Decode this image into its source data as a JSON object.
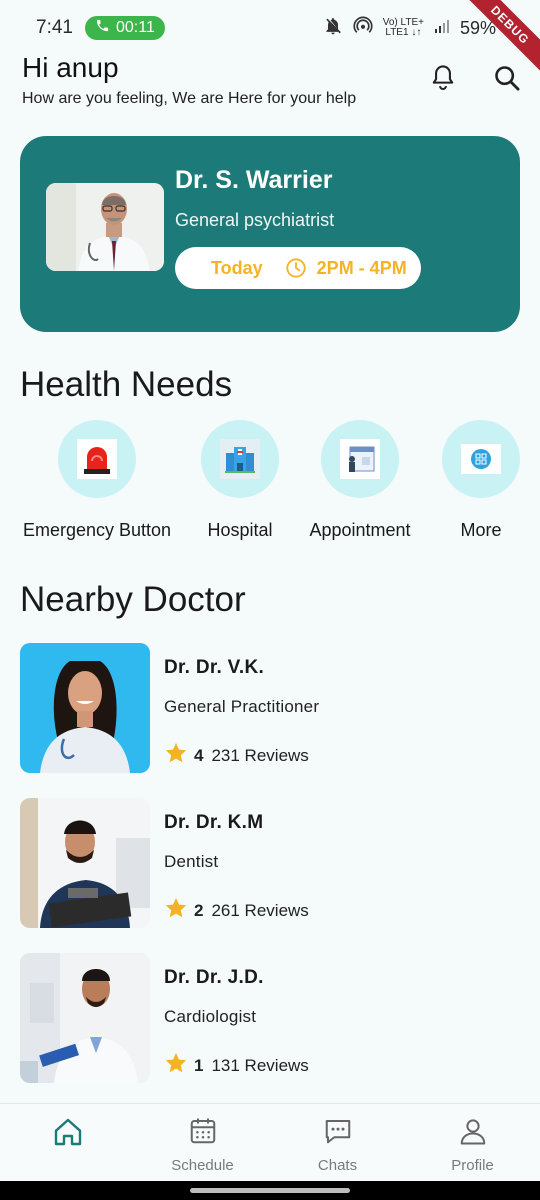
{
  "status_bar": {
    "time": "7:41",
    "call_timer": "00:11",
    "network_top": "Vo) LTE+",
    "network_bottom": "LTE1 ↓↑",
    "battery": "59%",
    "debug_label": "DEBUG"
  },
  "header": {
    "greeting": "Hi anup",
    "subtitle": "How are you feeling, We are Here for your help"
  },
  "appointment": {
    "doctor_name": "Dr. S. Warrier",
    "specialty": "General psychiatrist",
    "day": "Today",
    "time": "2PM - 4PM",
    "card_color": "#1c7b78",
    "accent_color": "#f5b324"
  },
  "health_needs": {
    "title": "Health Needs",
    "items": [
      {
        "label": "Emergency Button",
        "icon": "emergency-siren-icon"
      },
      {
        "label": "Hospital",
        "icon": "hospital-icon"
      },
      {
        "label": "Appointment",
        "icon": "appointment-icon"
      },
      {
        "label": "More",
        "icon": "more-services-icon"
      }
    ]
  },
  "nearby": {
    "title": "Nearby Doctor",
    "doctors": [
      {
        "name": "Dr. Dr. V.K.",
        "specialty": "General Practitioner",
        "rating": "4",
        "reviews": "231 Reviews"
      },
      {
        "name": "Dr. Dr. K.M",
        "specialty": "Dentist",
        "rating": "2",
        "reviews": "261 Reviews"
      },
      {
        "name": "Dr. Dr. J.D.",
        "specialty": "Cardiologist",
        "rating": "1",
        "reviews": "131 Reviews"
      }
    ]
  },
  "bottom_nav": {
    "home": "",
    "schedule": "Schedule",
    "chats": "Chats",
    "profile": "Profile",
    "active_color": "#1c7b78"
  }
}
